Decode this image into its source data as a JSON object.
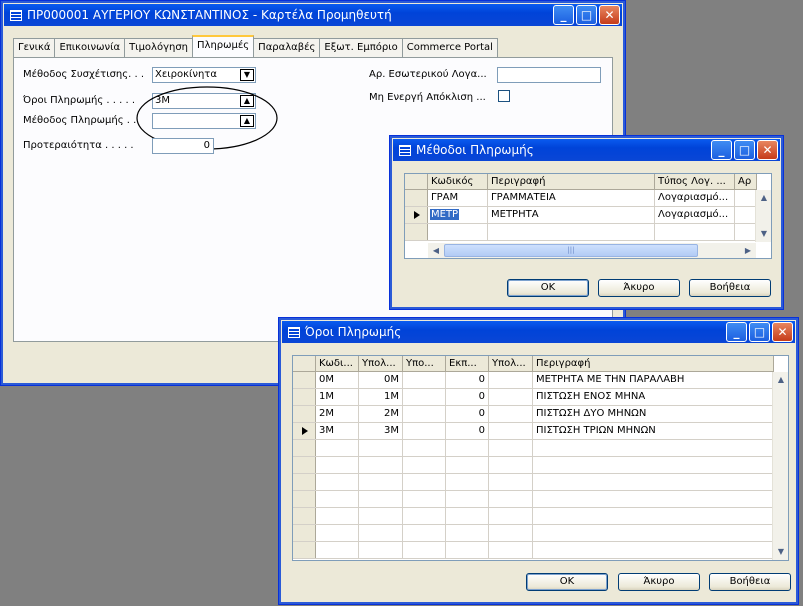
{
  "main_window": {
    "title": "ΠΡ000001 ΑΥΓΕΡΙΟΥ ΚΩΝΣΤΑΝΤΙΝΟΣ - Καρτέλα Προμηθευτή",
    "tabs": [
      "Γενικά",
      "Επικοινωνία",
      "Τιμολόγηση",
      "Πληρωμές",
      "Παραλαβές",
      "Εξωτ. Εμπόριο",
      "Commerce Portal"
    ],
    "fields": {
      "match_method_label": "Μέθοδος Συσχέτισης. . .",
      "match_method_value": "Χειροκίνητα",
      "payment_terms_label": "Όροι Πληρωμής . . . . .",
      "payment_terms_value": "3Μ",
      "payment_method_label": "Μέθοδος Πληρωμής . .",
      "payment_method_value": "",
      "priority_label": "Προτεραιότητα . . . . .",
      "priority_value": "0",
      "internal_account_label": "Αρ. Εσωτερικού Λογα...",
      "internal_account_value": "",
      "inactive_label": "Μη Ενεργή Απόκλιση ..."
    }
  },
  "payment_methods_window": {
    "title": "Μέθοδοι Πληρωμής",
    "columns": [
      "Κωδικός",
      "Περιγραφή",
      "Τύπος Λογ. ...",
      "Αρ"
    ],
    "rows": [
      {
        "code": "ΓΡΑΜ",
        "desc": "ΓΡΑΜΜΑΤΕΙΑ",
        "type": "Λογαριασμό..."
      },
      {
        "code": "ΜΕΤΡ",
        "desc": "ΜΕΤΡΗΤΑ",
        "type": "Λογαριασμό..."
      }
    ],
    "buttons": {
      "ok": "OK",
      "cancel": "Άκυρο",
      "help": "Βοήθεια"
    }
  },
  "payment_terms_window": {
    "title": "Όροι Πληρωμής",
    "columns": [
      "Κωδι...",
      "Υπολ...",
      "Υπο...",
      "Εκπ...",
      "Υπολ...",
      "Περιγραφή"
    ],
    "rows": [
      {
        "code": "0M",
        "calc": "0M",
        "c3": "",
        "disc": "0",
        "c5": "",
        "desc": "ΜΕΤΡΗΤΑ ΜΕ ΤΗΝ ΠΑΡΑΛΑΒΗ"
      },
      {
        "code": "1M",
        "calc": "1M",
        "c3": "",
        "disc": "0",
        "c5": "",
        "desc": "ΠΙΣΤΩΣΗ ΕΝΟΣ ΜΗΝΑ"
      },
      {
        "code": "2M",
        "calc": "2M",
        "c3": "",
        "disc": "0",
        "c5": "",
        "desc": "ΠΙΣΤΩΣΗ ΔΥΟ ΜΗΝΩΝ"
      },
      {
        "code": "3M",
        "calc": "3M",
        "c3": "",
        "disc": "0",
        "c5": "",
        "desc": "ΠΙΣΤΩΣΗ ΤΡΙΩΝ ΜΗΝΩΝ"
      }
    ],
    "buttons": {
      "ok": "OK",
      "cancel": "Άκυρο",
      "help": "Βοήθεια"
    }
  }
}
